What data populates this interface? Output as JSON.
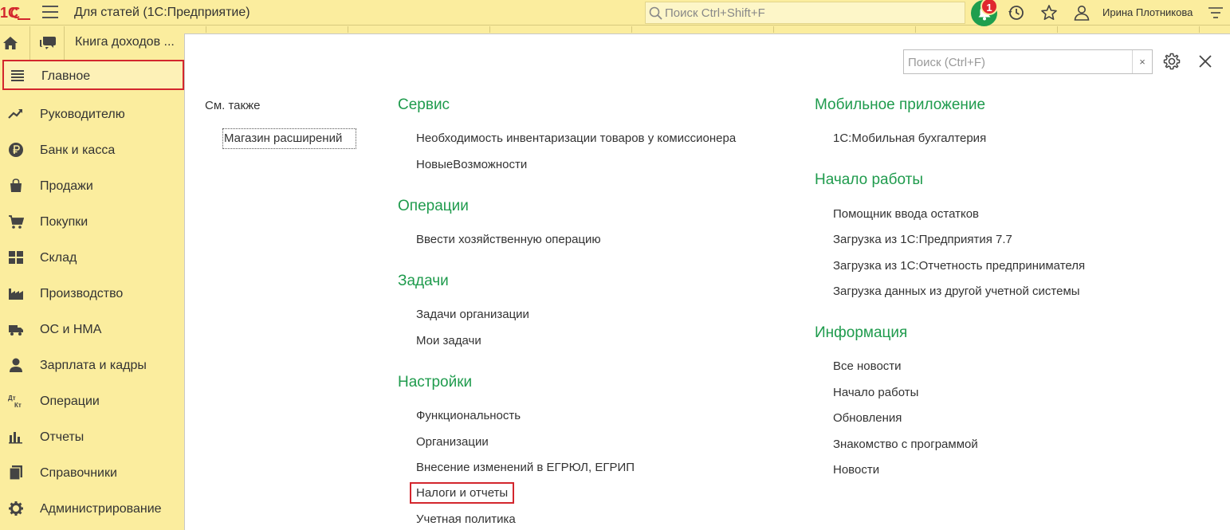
{
  "app": {
    "title": "Для статей  (1С:Предприятие)",
    "search_placeholder": "Поиск Ctrl+Shift+F",
    "notification_count": "1",
    "user_name": "Ирина Плотникова"
  },
  "tabs": {
    "open_tab": "Книга доходов ..."
  },
  "sidebar": {
    "items": [
      {
        "label": "Главное",
        "icon": "menu-list-icon"
      },
      {
        "label": "Руководителю",
        "icon": "trend-icon"
      },
      {
        "label": "Банк и касса",
        "icon": "ruble-coin-icon"
      },
      {
        "label": "Продажи",
        "icon": "bag-icon"
      },
      {
        "label": "Покупки",
        "icon": "cart-icon"
      },
      {
        "label": "Склад",
        "icon": "warehouse-icon"
      },
      {
        "label": "Производство",
        "icon": "factory-icon"
      },
      {
        "label": "ОС и НМА",
        "icon": "truck-icon"
      },
      {
        "label": "Зарплата и кадры",
        "icon": "person-icon"
      },
      {
        "label": "Операции",
        "icon": "dt-kt-icon"
      },
      {
        "label": "Отчеты",
        "icon": "bar-chart-icon"
      },
      {
        "label": "Справочники",
        "icon": "books-icon"
      },
      {
        "label": "Администрирование",
        "icon": "gear-icon"
      }
    ]
  },
  "panel": {
    "search_placeholder": "Поиск (Ctrl+F)",
    "clear_label": "×",
    "see_also": "См. также",
    "see_also_links": [
      "Магазин расширений"
    ],
    "col1": [
      {
        "title": "Сервис",
        "links": [
          "Необходимость инвентаризации товаров у комиссионера",
          "НовыеВозможности"
        ]
      },
      {
        "title": "Операции",
        "links": [
          "Ввести хозяйственную операцию"
        ]
      },
      {
        "title": "Задачи",
        "links": [
          "Задачи организации",
          "Мои задачи"
        ]
      },
      {
        "title": "Настройки",
        "links": [
          "Функциональность",
          "Организации",
          "Внесение изменений в ЕГРЮЛ, ЕГРИП",
          "Налоги и отчеты",
          "Учетная политика"
        ]
      }
    ],
    "col2": [
      {
        "title": "Мобильное приложение",
        "links": [
          "1С:Мобильная бухгалтерия"
        ]
      },
      {
        "title": "Начало работы",
        "links": [
          "Помощник ввода остатков",
          "Загрузка из 1С:Предприятия 7.7",
          "Загрузка из 1С:Отчетность предпринимателя",
          "Загрузка данных из другой учетной системы"
        ]
      },
      {
        "title": "Информация",
        "links": [
          "Все новости",
          "Начало работы",
          "Обновления",
          "Знакомство с программой",
          "Новости"
        ]
      }
    ]
  },
  "colors": {
    "accent_green": "#1f9b4d",
    "highlight_red": "#d3262d",
    "sidebar_yellow": "#fbed9e"
  }
}
